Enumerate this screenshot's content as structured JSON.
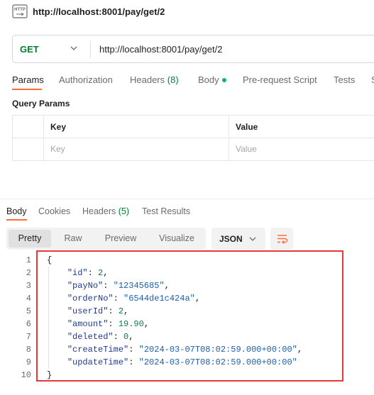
{
  "window": {
    "title": "http://localhost:8001/pay/get/2"
  },
  "request": {
    "method": "GET",
    "url": "http://localhost:8001/pay/get/2"
  },
  "request_tabs": {
    "params": "Params",
    "authorization": "Authorization",
    "headers": "Headers",
    "headers_count": "(8)",
    "body": "Body",
    "prerequest": "Pre-request Script",
    "tests": "Tests",
    "settings_partial": "S"
  },
  "query_params": {
    "title": "Query Params",
    "col_key": "Key",
    "col_value": "Value",
    "key_placeholder": "Key",
    "value_placeholder": "Value"
  },
  "response_tabs": {
    "body": "Body",
    "cookies": "Cookies",
    "headers": "Headers",
    "headers_count": "(5)",
    "test_results": "Test Results"
  },
  "view_modes": {
    "pretty": "Pretty",
    "raw": "Raw",
    "preview": "Preview",
    "visualize": "Visualize",
    "format": "JSON"
  },
  "response_json": {
    "open_brace": "{",
    "close_brace": "}",
    "line_numbers": [
      "1",
      "2",
      "3",
      "4",
      "5",
      "6",
      "7",
      "8",
      "9",
      "10"
    ],
    "fields": [
      {
        "key": "\"id\"",
        "value": "2",
        "type": "num"
      },
      {
        "key": "\"payNo\"",
        "value": "\"12345685\"",
        "type": "str"
      },
      {
        "key": "\"orderNo\"",
        "value": "\"6544de1c424a\"",
        "type": "str"
      },
      {
        "key": "\"userId\"",
        "value": "2",
        "type": "num"
      },
      {
        "key": "\"amount\"",
        "value": "19.90",
        "type": "num"
      },
      {
        "key": "\"deleted\"",
        "value": "0",
        "type": "num"
      },
      {
        "key": "\"createTime\"",
        "value": "\"2024-03-07T08:02:59.000+00:00\"",
        "type": "str"
      },
      {
        "key": "\"updateTime\"",
        "value": "\"2024-03-07T08:02:59.000+00:00\"",
        "type": "str"
      }
    ]
  },
  "colors": {
    "accent": "#ff6c37",
    "method_get": "#007f31",
    "highlight_box": "#e53935"
  }
}
